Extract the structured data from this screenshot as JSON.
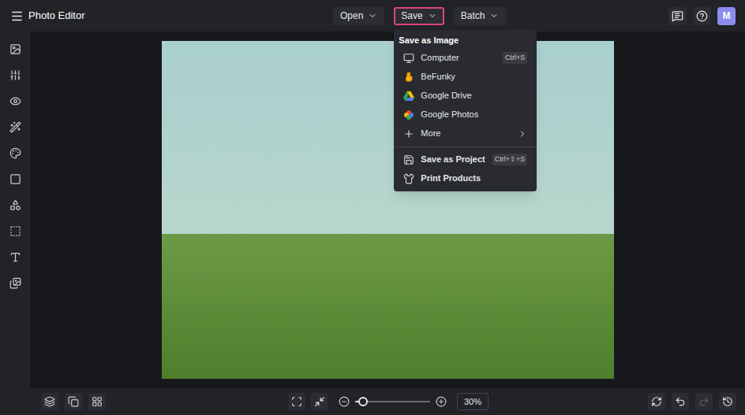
{
  "window": {
    "title": "Photo Editor"
  },
  "top_menu": [
    {
      "label": "Open",
      "selected": false
    },
    {
      "label": "Save",
      "selected": true
    },
    {
      "label": "Batch",
      "selected": false
    }
  ],
  "avatar": {
    "initial": "M"
  },
  "save_menu": {
    "sections": [
      {
        "title": "Save as Image",
        "items": [
          {
            "label": "Computer",
            "shortcut": "Ctrl+S",
            "submenu": false
          },
          {
            "label": "BeFunky",
            "shortcut": "",
            "submenu": false
          },
          {
            "label": "Google Drive",
            "shortcut": "",
            "submenu": false
          },
          {
            "label": "Google Photos",
            "shortcut": "",
            "submenu": false
          },
          {
            "label": "More",
            "shortcut": "",
            "submenu": true
          }
        ]
      },
      {
        "title": "",
        "items": [
          {
            "label": "Save as Project",
            "shortcut": "Ctrl+⇧+S",
            "submenu": false
          },
          {
            "label": "Print Products",
            "shortcut": "",
            "submenu": false
          }
        ]
      }
    ]
  },
  "zoom": {
    "level": 0.1,
    "reading": "30%"
  },
  "history": {
    "undo_disabled": false,
    "redo_disabled": true
  }
}
